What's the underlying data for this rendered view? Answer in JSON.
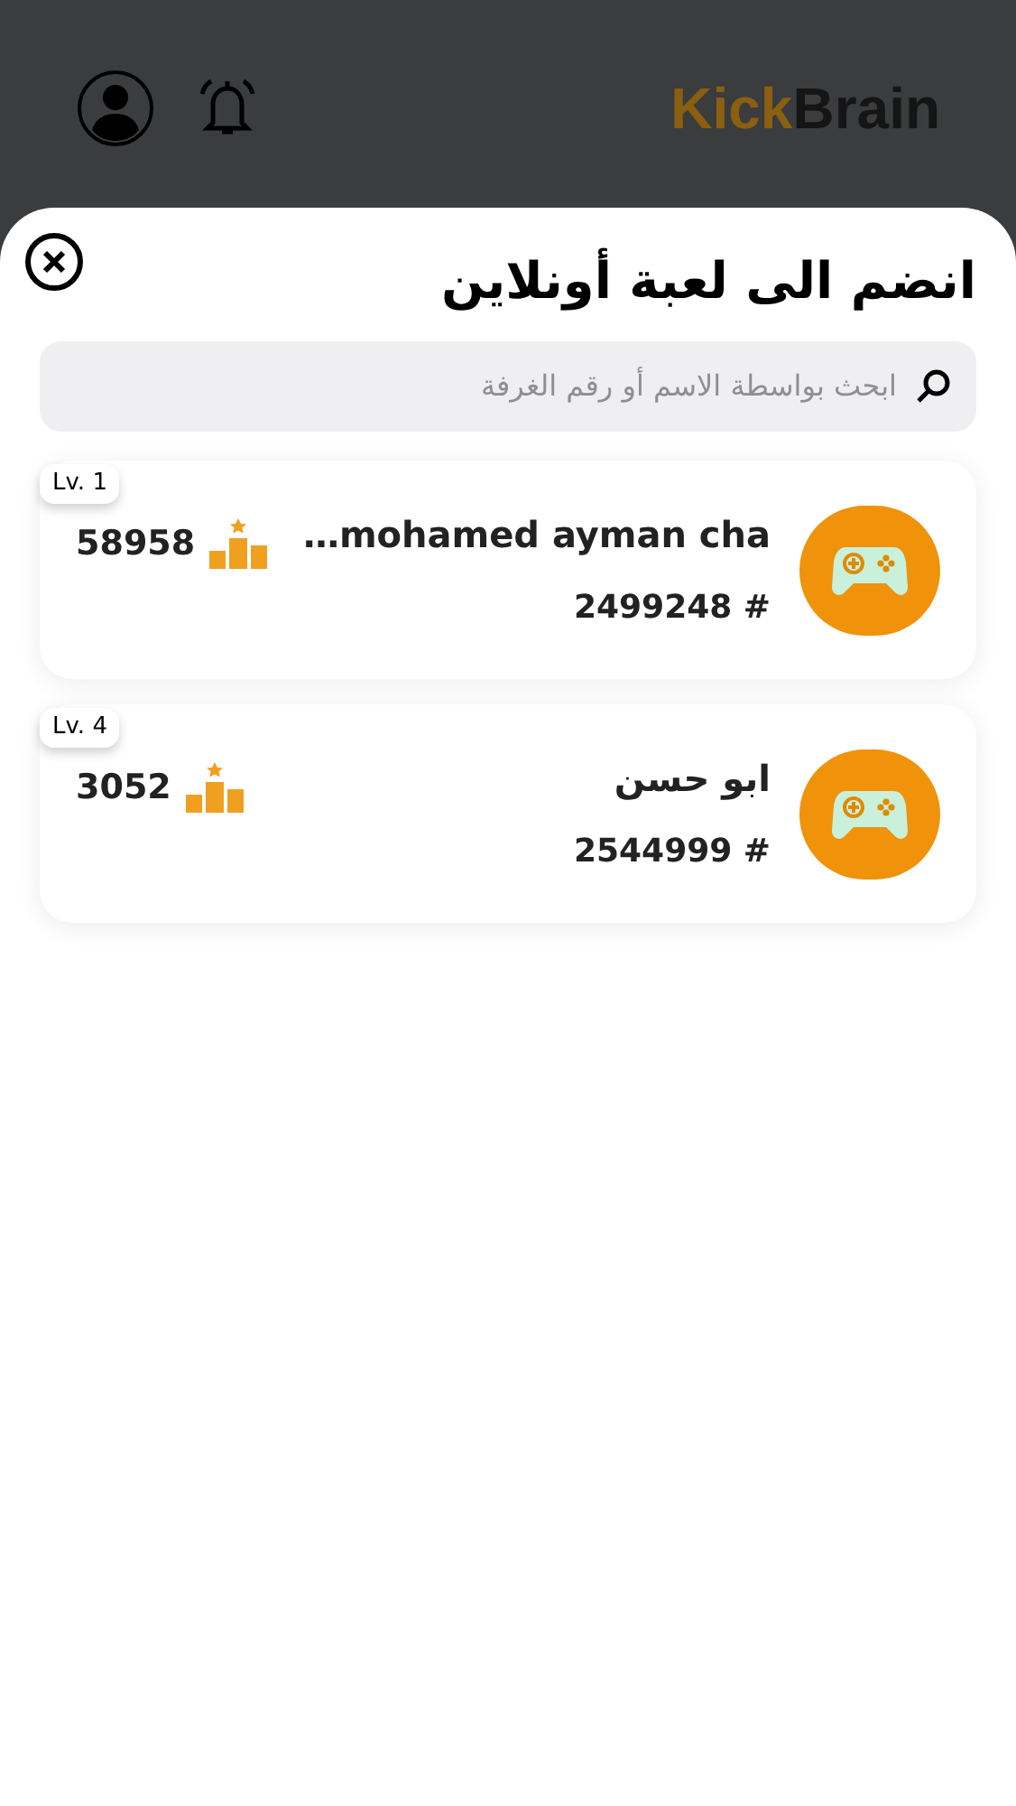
{
  "header": {
    "logo_first": "Kick",
    "logo_second": "Brain"
  },
  "sheet": {
    "title": "انضم الى لعبة أونلاين",
    "search": {
      "placeholder": "ابحث بواسطة الاسم أو رقم الغرفة"
    }
  },
  "rooms": [
    {
      "level": "Lv. 1",
      "name": "…mohamed ayman cha",
      "room": "2499248 #",
      "score": "58958"
    },
    {
      "level": "Lv. 4",
      "name": "ابو حسن",
      "room": "2544999 #",
      "score": "3052"
    }
  ]
}
